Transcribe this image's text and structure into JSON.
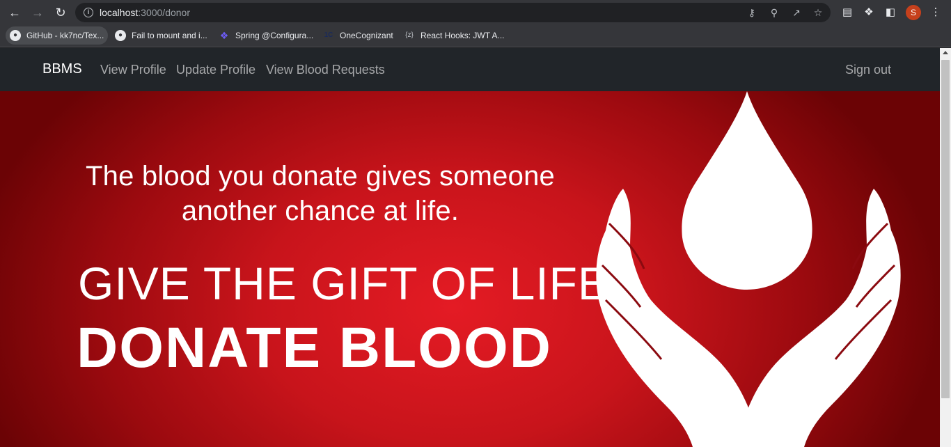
{
  "browser": {
    "url_host": "localhost",
    "url_path": ":3000/donor",
    "avatar_letter": "S",
    "avatar_color": "#c6401c"
  },
  "bookmarks": [
    {
      "label": "GitHub - kk7nc/Tex...",
      "icon": "github-icon"
    },
    {
      "label": "Fail to mount and i...",
      "icon": "github-icon"
    },
    {
      "label": "Spring @Configura...",
      "icon": "spring-icon"
    },
    {
      "label": "OneCognizant",
      "icon": "onecognizant-icon"
    },
    {
      "label": "React Hooks: JWT A...",
      "icon": "bracket-z-icon"
    }
  ],
  "navbar": {
    "brand": "BBMS",
    "links": [
      "View Profile",
      "Update Profile",
      "View Blood Requests"
    ],
    "signout": "Sign out"
  },
  "hero": {
    "tagline_line1": "The blood you donate gives someone",
    "tagline_line2": "another chance at life.",
    "headline1": "GIVE THE GIFT OF LIFE",
    "headline2": "DONATE BLOOD",
    "background_color": "#e41b24"
  }
}
